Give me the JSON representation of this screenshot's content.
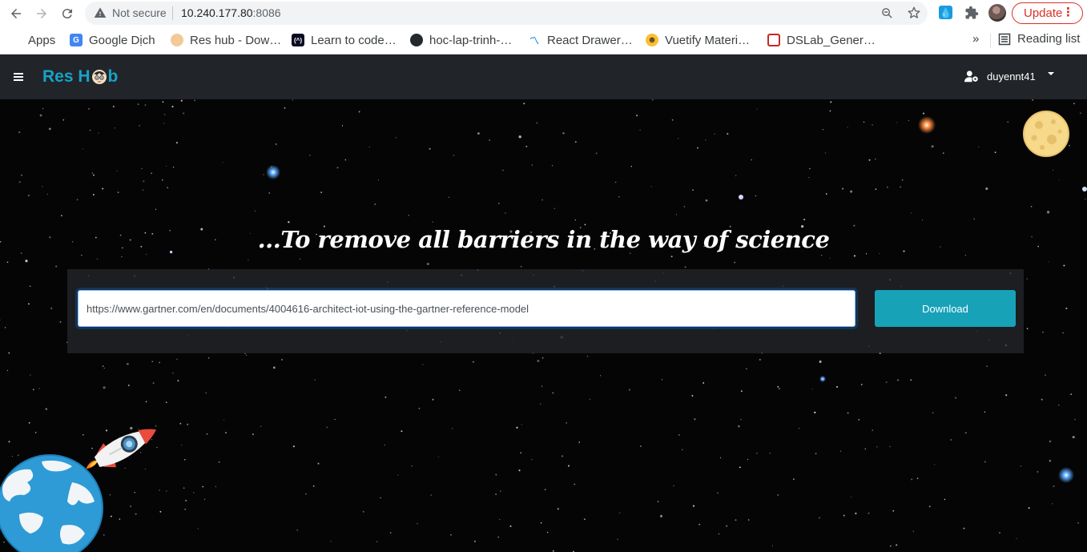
{
  "browser": {
    "security_label": "Not secure",
    "url_host": "10.240.177.80",
    "url_port": ":8086",
    "update_label": "Update",
    "icons": [
      "back-arrow-icon",
      "forward-arrow-icon",
      "reload-icon",
      "warning-icon",
      "zoom-icon",
      "star-icon",
      "extension-icon",
      "puzzle-icon",
      "profile-avatar",
      "more-vert-icon"
    ]
  },
  "bookmarks": {
    "items": [
      {
        "label": "Apps",
        "icon": "apps-grid-icon"
      },
      {
        "label": "Google Dịch",
        "icon": "google-translate-icon"
      },
      {
        "label": "Res hub - Dow…",
        "icon": "res-hub-icon"
      },
      {
        "label": "Learn to code…",
        "icon": "freecodecamp-icon"
      },
      {
        "label": "hoc-lap-trinh-…",
        "icon": "github-icon"
      },
      {
        "label": "React Drawer…",
        "icon": "react-drawer-icon"
      },
      {
        "label": "Vuetify Materi…",
        "icon": "vuetify-icon"
      },
      {
        "label": "DSLab_Gener…",
        "icon": "dslab-icon"
      }
    ],
    "more": "»",
    "reading_list": "Reading list"
  },
  "app": {
    "brand": {
      "before": "Res H",
      "after": "b"
    },
    "username": "duyennt41",
    "tagline": "...To remove all barriers in the way of science",
    "search": {
      "value": "https://www.gartner.com/en/documents/4004616-architect-iot-using-the-gartner-reference-model",
      "placeholder": ""
    },
    "download_label": "Download"
  },
  "colors": {
    "accent": "#17a2b8",
    "navbar": "#212529",
    "update_red": "#d93025"
  }
}
